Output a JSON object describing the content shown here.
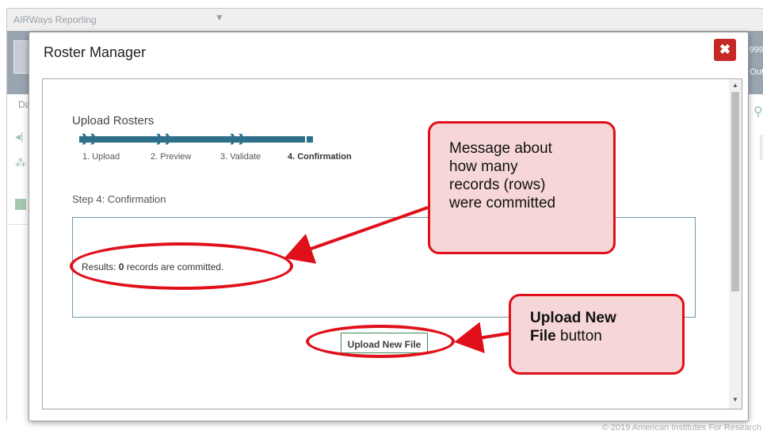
{
  "background_app": {
    "title": "AIRWays Reporting",
    "banner_text_1": "999",
    "banner_text_2": "Out",
    "tab_label": "Da",
    "copyright": "© 2019 American Institutes For Research"
  },
  "modal": {
    "title": "Roster Manager",
    "section_title": "Upload Rosters",
    "steps": [
      {
        "label": "1. Upload",
        "active": false
      },
      {
        "label": "2. Preview",
        "active": false
      },
      {
        "label": "3. Validate",
        "active": false
      },
      {
        "label": "4. Confirmation",
        "active": true
      }
    ],
    "step_heading": "Step 4: Confirmation",
    "results": {
      "prefix": "Results: ",
      "count": "0",
      "suffix": " records are committed."
    },
    "upload_button_label": "Upload New File"
  },
  "annotations": {
    "callout_1": {
      "lines": [
        "Message about",
        "how many",
        "records (rows)",
        "were committed"
      ]
    },
    "callout_2": {
      "line1_bold": "Upload New",
      "line2_bold": "File",
      "line2_rest": " button"
    },
    "annotation_color": "#e0101a",
    "callout_fill": "#f6d6d6"
  },
  "colors": {
    "progress": "#2e6f8a",
    "close_button": "#c62828",
    "upload_button_border": "#3a8a5a"
  }
}
